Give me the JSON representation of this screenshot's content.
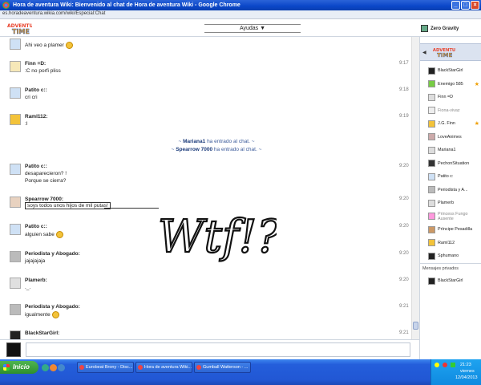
{
  "window": {
    "title": "Hora de aventura Wiki: Bienvenido al chat de Hora de aventura Wiki - Google Chrome"
  },
  "browser": {
    "url": "es.horadeaventura.wikia.com/wiki/Especial:Chat"
  },
  "header": {
    "logo_text": "Adventure TIME",
    "menu_label": "Ayudas ▼",
    "current_user": "Zero Gravity"
  },
  "messages": [
    {
      "user": "",
      "lines": [
        "Ahi veo a plamer"
      ],
      "time": "",
      "smiley": true
    },
    {
      "user": "Finn =D:",
      "lines": [
        ":C no porfi pliss"
      ],
      "time": "9:17"
    },
    {
      "user": "Patito c::",
      "lines": [
        "cri cri"
      ],
      "time": "9:18"
    },
    {
      "user": "Raml112:",
      "lines": [
        ":I"
      ],
      "time": "9:19"
    },
    {
      "user": "Patito c::",
      "lines": [
        "desaparecieron?  !",
        "Porque se cierra?"
      ],
      "time": "9:20"
    },
    {
      "user": "Spearrow 7000:",
      "lines": [
        "soys todos unos hijos de mil putas!"
      ],
      "time": "9:20"
    },
    {
      "user": "Patito c::",
      "lines": [
        "alguien sabe"
      ],
      "time": "9:20",
      "smiley": true
    },
    {
      "user": "Periodista y Abogado:",
      "lines": [
        "jajajajaja"
      ],
      "time": "9:20"
    },
    {
      "user": "Plamerb:",
      "lines": [
        "._."
      ],
      "time": "9:20"
    },
    {
      "user": "Periodista y Abogado:",
      "lines": [
        "igualmente"
      ],
      "time": "9:21",
      "smiley": true
    },
    {
      "user": "BlackStarGirl:",
      "lines": [
        ""
      ],
      "time": "9:21"
    }
  ],
  "join_notices": [
    {
      "prefix": "~ ",
      "user": "Mariana1",
      "text": " ha entrado al chat. ~"
    },
    {
      "prefix": "~ ",
      "user": "Spearrow 7000",
      "text": " ha entrado al chat. ~"
    }
  ],
  "annotation_text": "Wtf!?",
  "sidebar": {
    "users": [
      {
        "name": "BlackStarGirl",
        "star": false,
        "away": false
      },
      {
        "name": "Enemigo 585",
        "star": true,
        "away": false
      },
      {
        "name": "Finn =D",
        "star": false,
        "away": false
      },
      {
        "name": "Fiona-vivaz",
        "star": false,
        "away": true
      },
      {
        "name": "J.G. Finn",
        "star": true,
        "away": false
      },
      {
        "name": "LoveAnimes",
        "star": false,
        "away": false
      },
      {
        "name": "Mariana1",
        "star": false,
        "away": false
      },
      {
        "name": "PechonSituation",
        "star": false,
        "away": false
      },
      {
        "name": "Patito c:",
        "star": false,
        "away": false
      },
      {
        "name": "Periodista y A...",
        "star": false,
        "away": false
      },
      {
        "name": "Plamerb",
        "star": false,
        "away": false
      },
      {
        "name": "Princess Fungo",
        "star": false,
        "away": true,
        "status": "Ausente"
      },
      {
        "name": "Príncipe Pesadilla",
        "star": false,
        "away": false
      },
      {
        "name": "Raml112",
        "star": false,
        "away": false
      },
      {
        "name": "Sphumano",
        "star": false,
        "away": false
      }
    ],
    "private_label": "Mensajes privados",
    "private_users": [
      "BlackStarGirl"
    ]
  },
  "taskbar": {
    "start_label": "Inicio",
    "tasks": [
      "Eurobeat Brony - Disc...",
      "Hora de aventura Wiki...",
      "Gumball Watterson - ..."
    ],
    "clock": {
      "time": "21:23",
      "day": "viernes",
      "date": "12/04/2013"
    }
  },
  "colors": {
    "titlebar": "#0a46c8",
    "taskbar": "#245edb",
    "link": "#1a3a7a",
    "star": "#f0a000"
  }
}
